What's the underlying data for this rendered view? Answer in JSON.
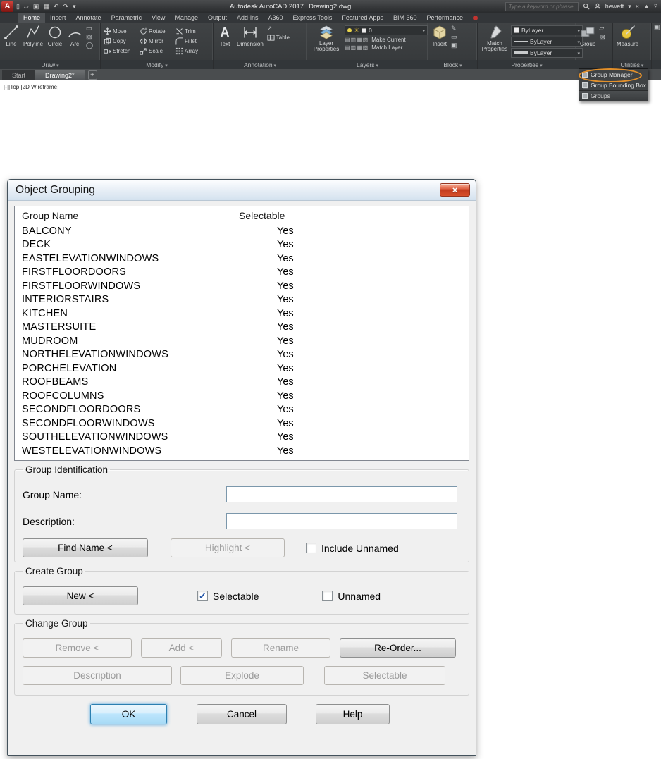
{
  "titlebar": {
    "app_title": "Autodesk AutoCAD 2017",
    "doc_title": "Drawing2.dwg",
    "search_placeholder": "Type a keyword or phrase",
    "user": "hewett"
  },
  "ribbon": {
    "tabs": [
      {
        "label": "Home",
        "active": true
      },
      {
        "label": "Insert"
      },
      {
        "label": "Annotate"
      },
      {
        "label": "Parametric"
      },
      {
        "label": "View"
      },
      {
        "label": "Manage"
      },
      {
        "label": "Output"
      },
      {
        "label": "Add-ins"
      },
      {
        "label": "A360"
      },
      {
        "label": "Express Tools"
      },
      {
        "label": "Featured Apps"
      },
      {
        "label": "BIM 360"
      },
      {
        "label": "Performance"
      }
    ],
    "draw": {
      "label": "Draw",
      "line": "Line",
      "polyline": "Polyline",
      "circle": "Circle",
      "arc": "Arc"
    },
    "modify": {
      "label": "Modify",
      "items": [
        "Move",
        "Rotate",
        "Trim",
        "Copy",
        "Mirror",
        "Fillet",
        "Stretch",
        "Scale",
        "Array"
      ]
    },
    "annotation": {
      "label": "Annotation",
      "text": "Text",
      "dimension": "Dimension",
      "table": "Table"
    },
    "layers": {
      "label": "Layers",
      "layer_properties": "Layer Properties",
      "make_current": "Make Current",
      "match_layer": "Match Layer",
      "current_layer": "0"
    },
    "block": {
      "label": "Block",
      "insert": "Insert"
    },
    "properties": {
      "label": "Properties",
      "match_properties": "Match Properties",
      "color": "ByLayer",
      "linetype": "ByLayer",
      "lineweight": "ByLayer"
    },
    "groups": {
      "group": "Group"
    },
    "utilities": {
      "label": "Utilities",
      "measure": "Measure"
    }
  },
  "group_menu": {
    "items": [
      {
        "label": "Group Manager",
        "circled": true
      },
      {
        "label": "Group Bounding Box"
      },
      {
        "label": "Groups",
        "panel_title": true
      }
    ]
  },
  "file_tabs": {
    "start": "Start",
    "drawing": "Drawing2*"
  },
  "viewport": {
    "label": "[-][Top][2D Wireframe]"
  },
  "dialog": {
    "title": "Object Grouping",
    "list": {
      "name_header": "Group Name",
      "selectable_header": "Selectable",
      "rows": [
        {
          "name": "BALCONY",
          "selectable": "Yes"
        },
        {
          "name": "DECK",
          "selectable": "Yes"
        },
        {
          "name": "EASTELEVATIONWINDOWS",
          "selectable": "Yes"
        },
        {
          "name": "FIRSTFLOORDOORS",
          "selectable": "Yes"
        },
        {
          "name": "FIRSTFLOORWINDOWS",
          "selectable": "Yes"
        },
        {
          "name": "INTERIORSTAIRS",
          "selectable": "Yes"
        },
        {
          "name": "KITCHEN",
          "selectable": "Yes"
        },
        {
          "name": "MASTERSUITE",
          "selectable": "Yes"
        },
        {
          "name": "MUDROOM",
          "selectable": "Yes"
        },
        {
          "name": "NORTHELEVATIONWINDOWS",
          "selectable": "Yes"
        },
        {
          "name": "PORCHELEVATION",
          "selectable": "Yes"
        },
        {
          "name": "ROOFBEAMS",
          "selectable": "Yes"
        },
        {
          "name": "ROOFCOLUMNS",
          "selectable": "Yes"
        },
        {
          "name": "SECONDFLOORDOORS",
          "selectable": "Yes"
        },
        {
          "name": "SECONDFLOORWINDOWS",
          "selectable": "Yes"
        },
        {
          "name": "SOUTHELEVATIONWINDOWS",
          "selectable": "Yes"
        },
        {
          "name": "WESTELEVATIONWINDOWS",
          "selectable": "Yes"
        }
      ]
    },
    "identification": {
      "legend": "Group Identification",
      "group_name_label": "Group Name:",
      "group_name_value": "",
      "description_label": "Description:",
      "description_value": "",
      "find_name": "Find Name <",
      "highlight": "Highlight <",
      "include_unnamed": "Include Unnamed"
    },
    "create": {
      "legend": "Create Group",
      "new": "New <",
      "selectable": "Selectable",
      "unnamed": "Unnamed"
    },
    "change": {
      "legend": "Change Group",
      "remove": "Remove <",
      "add": "Add <",
      "rename": "Rename",
      "reorder": "Re-Order...",
      "description": "Description",
      "explode": "Explode",
      "selectable": "Selectable"
    },
    "footer": {
      "ok": "OK",
      "cancel": "Cancel",
      "help": "Help"
    },
    "colors": {
      "accent_blue": "#2c7fb0",
      "close_red": "#c03a1d",
      "annotation_orange": "#e2902c"
    }
  }
}
